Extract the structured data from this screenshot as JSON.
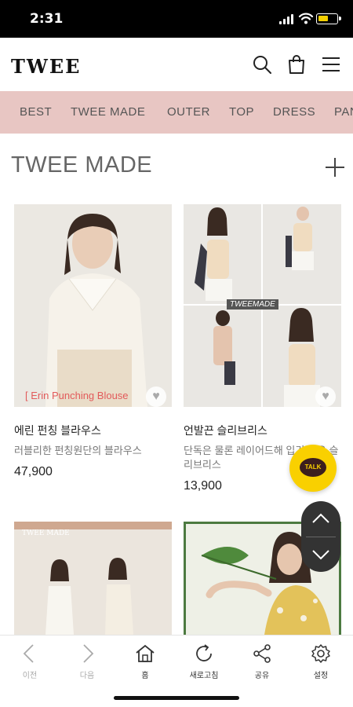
{
  "status_bar": {
    "time": "2:31"
  },
  "header": {
    "logo": "TWEE",
    "icons": [
      "search-icon",
      "shopping-bag-icon",
      "menu-icon"
    ]
  },
  "categories": [
    "BEST",
    "TWEE MADE",
    "OUTER",
    "TOP",
    "DRESS",
    "PANTS"
  ],
  "section": {
    "title": "TWEE MADE"
  },
  "products": [
    {
      "name": "에린 펀칭 블라우스",
      "description": "러블리한 펀칭원단의 블라우스",
      "price": "47,900",
      "banner": "[ Erin Punching Blouse"
    },
    {
      "name": "언발끈 슬리브리스",
      "description": "단독은 물론 레이어드해 입기 좋은 슬리브리스",
      "price": "13,900",
      "watermark": "TWEEMADE"
    },
    {
      "label": "TWEE MADE"
    },
    {}
  ],
  "chat_button": {
    "label": "TALK"
  },
  "bottom_nav": [
    {
      "label": "이전",
      "icon": "back-icon"
    },
    {
      "label": "다음",
      "icon": "forward-icon"
    },
    {
      "label": "홈",
      "icon": "home-icon"
    },
    {
      "label": "새로고침",
      "icon": "refresh-icon"
    },
    {
      "label": "공유",
      "icon": "share-icon"
    },
    {
      "label": "설정",
      "icon": "settings-icon"
    }
  ],
  "colors": {
    "category_bar": "#e8c6c3",
    "chat_yellow": "#f9d000"
  }
}
